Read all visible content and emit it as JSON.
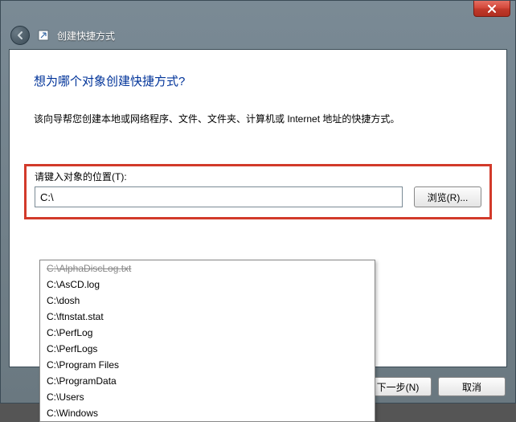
{
  "window": {
    "title": "创建快捷方式"
  },
  "wizard": {
    "heading": "想为哪个对象创建快捷方式?",
    "description": "该向导帮您创建本地或网络程序、文件、文件夹、计算机或 Internet 地址的快捷方式。",
    "location_label": "请键入对象的位置(T):",
    "location_value": "C:\\",
    "browse_label": "浏览(R)..."
  },
  "suggestions": [
    {
      "text": "C:\\AlphaDiscLog.txt",
      "disabled": true
    },
    {
      "text": "C:\\AsCD.log",
      "disabled": false
    },
    {
      "text": "C:\\dosh",
      "disabled": false
    },
    {
      "text": "C:\\ftnstat.stat",
      "disabled": false
    },
    {
      "text": "C:\\PerfLog",
      "disabled": false
    },
    {
      "text": "C:\\PerfLogs",
      "disabled": false
    },
    {
      "text": "C:\\Program Files",
      "disabled": false
    },
    {
      "text": "C:\\ProgramData",
      "disabled": false
    },
    {
      "text": "C:\\Users",
      "disabled": false
    },
    {
      "text": "C:\\Windows",
      "disabled": false
    }
  ],
  "buttons": {
    "next": "下一步(N)",
    "cancel": "取消"
  },
  "colors": {
    "highlight_border": "#d23a2a",
    "heading": "#003399"
  }
}
